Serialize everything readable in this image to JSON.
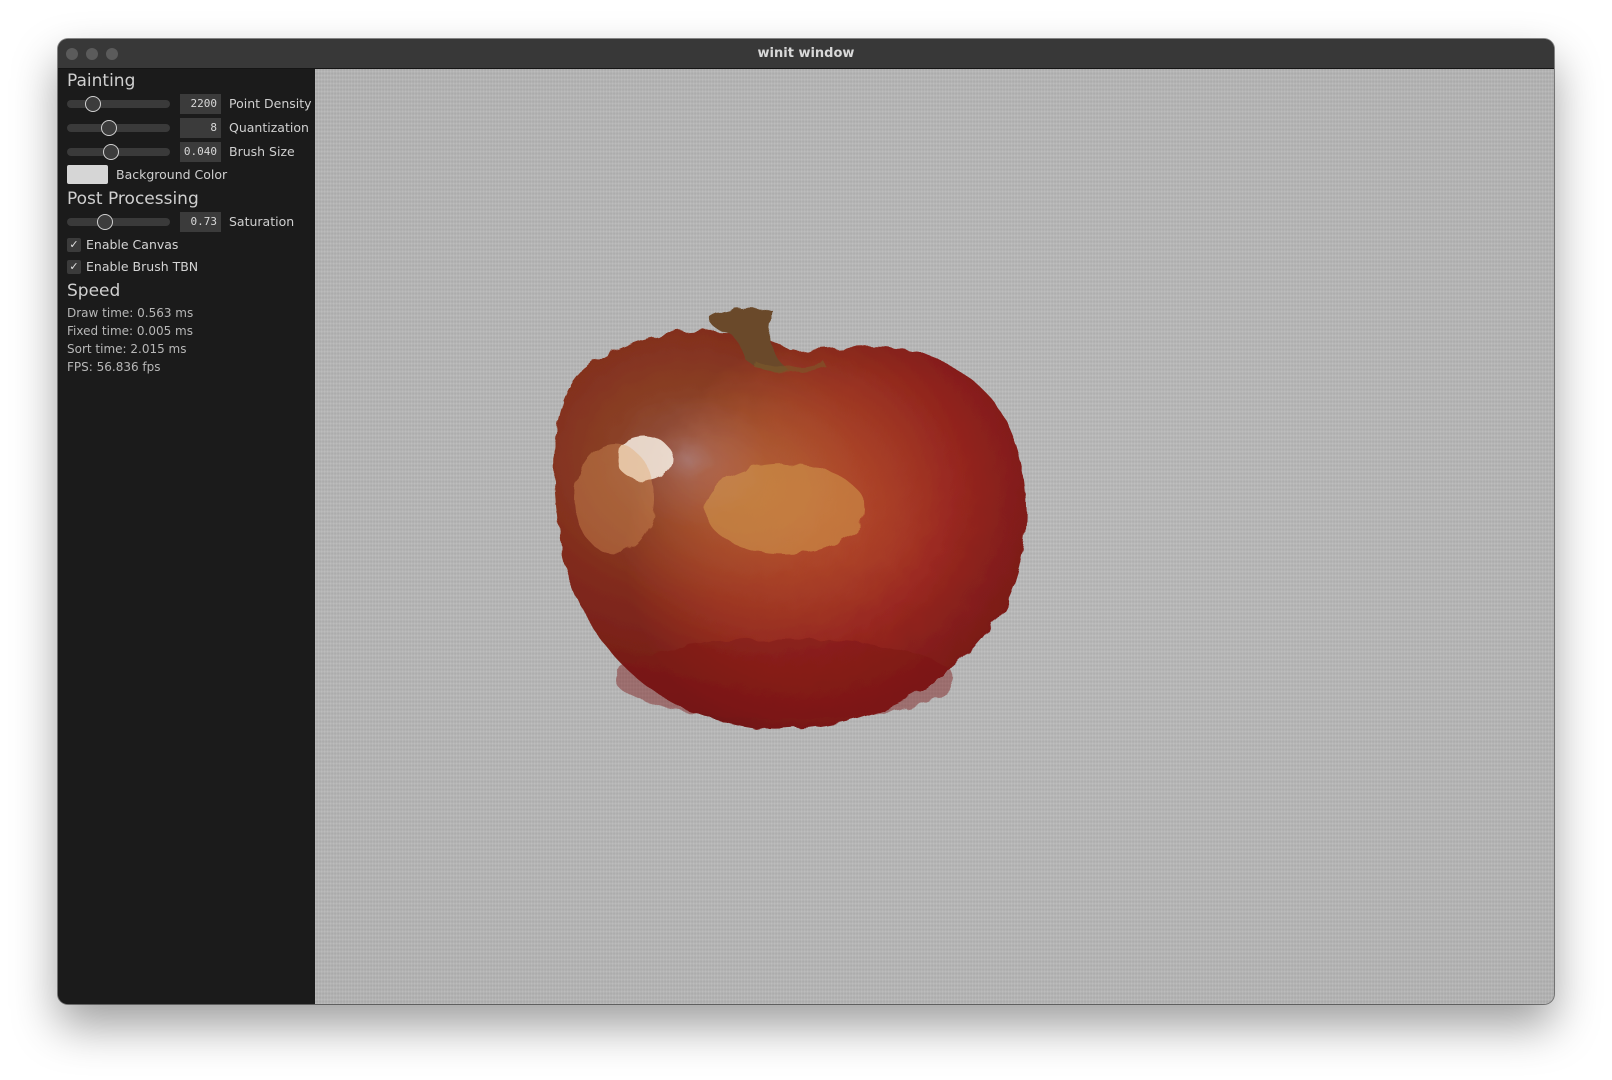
{
  "window": {
    "title": "winit window"
  },
  "painting": {
    "heading": "Painting",
    "point_density": {
      "label": "Point Density",
      "value": "2200",
      "fraction": 0.25
    },
    "quantization": {
      "label": "Quantization",
      "value": "8",
      "fraction": 0.41
    },
    "brush_size": {
      "label": "Brush Size",
      "value": "0.040",
      "fraction": 0.43
    },
    "background_color": {
      "label": "Background Color",
      "color": "#d6d6d6"
    }
  },
  "post_processing": {
    "heading": "Post Processing",
    "saturation": {
      "label": "Saturation",
      "value": "0.73",
      "fraction": 0.37
    },
    "enable_canvas": {
      "label": "Enable Canvas",
      "checked": true
    },
    "enable_brush_tbn": {
      "label": "Enable Brush TBN",
      "checked": true
    }
  },
  "speed": {
    "heading": "Speed",
    "draw_time": "Draw time: 0.563 ms",
    "fixed_time": "Fixed time: 0.005 ms",
    "sort_time": "Sort time: 2.015 ms",
    "fps": "FPS: 56.836 fps"
  },
  "canvas": {
    "subject": "apple",
    "background_color": "#b6b6b6"
  }
}
